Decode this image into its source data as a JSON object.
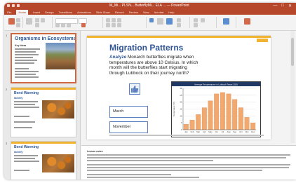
{
  "window": {
    "title": "M_Mi... PLSN... ButterflyMi... ELA ...  —  PowerPoint",
    "controls": [
      "—",
      "□",
      "✕"
    ]
  },
  "ribbon_tabs": [
    "File",
    "Home",
    "Insert",
    "Design",
    "Transitions",
    "Animations",
    "Slide Show",
    "Record",
    "Review",
    "View",
    "Acrobat",
    "Help"
  ],
  "active_tab_index": 1,
  "thumbnails": [
    {
      "num": "1",
      "title": "Organisms in Ecosystems",
      "sub": "Key Ideas"
    },
    {
      "num": "2",
      "title": "Bend Warming",
      "sub": "Identify"
    },
    {
      "num": "3",
      "title": "Bend Warming",
      "sub": "Identify"
    }
  ],
  "slide": {
    "title": "Migration Patterns",
    "analyze_label": "Analyze",
    "analyze_text": "Monarch butterflies migrate when temperatures are above 10 Celsius. In which month will the butterflies start migrating through Lubbock on their journey north?",
    "answers": [
      "March",
      "November"
    ]
  },
  "chart_data": {
    "type": "bar",
    "title": "Average Temperatures in Lubbock Texas 2020",
    "ylabel": "Temperature (°C)",
    "categories": [
      "Jan",
      "Feb",
      "Mar",
      "Apr",
      "May",
      "Jun",
      "Jul",
      "Aug",
      "Sep",
      "Oct",
      "Nov",
      "Dec"
    ],
    "values": [
      4,
      7,
      11,
      16,
      21,
      26,
      27,
      26,
      22,
      16,
      9,
      5
    ],
    "ylim": [
      0,
      30
    ],
    "bar_color": "#f2a96f"
  },
  "notes": {
    "label": "Lesson notes"
  },
  "colors": {
    "accent": "#b7472a",
    "title_blue": "#2f5597",
    "band_orange": "#f1b332"
  }
}
